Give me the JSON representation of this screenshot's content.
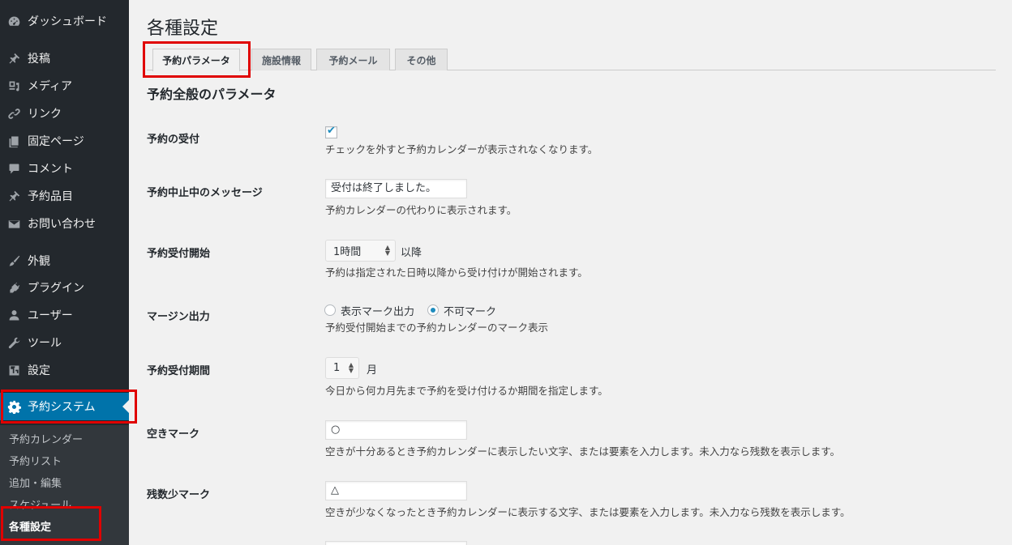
{
  "sidebar": {
    "items": [
      {
        "label": "ダッシュボード",
        "icon": "dashboard-icon"
      },
      {
        "label": "投稿",
        "icon": "pin-icon"
      },
      {
        "label": "メディア",
        "icon": "media-icon"
      },
      {
        "label": "リンク",
        "icon": "link-icon"
      },
      {
        "label": "固定ページ",
        "icon": "page-icon"
      },
      {
        "label": "コメント",
        "icon": "comment-icon"
      },
      {
        "label": "予約品目",
        "icon": "pin-icon"
      },
      {
        "label": "お問い合わせ",
        "icon": "mail-icon"
      },
      {
        "label": "外観",
        "icon": "brush-icon"
      },
      {
        "label": "プラグイン",
        "icon": "plugin-icon"
      },
      {
        "label": "ユーザー",
        "icon": "user-icon"
      },
      {
        "label": "ツール",
        "icon": "wrench-icon"
      },
      {
        "label": "設定",
        "icon": "settings-icon"
      },
      {
        "label": "予約システム",
        "icon": "gear-icon"
      }
    ],
    "submenu": [
      "予約カレンダー",
      "予約リスト",
      "追加・編集",
      "スケジュール",
      "各種設定"
    ]
  },
  "main": {
    "title": "各種設定",
    "tabs": [
      "予約パラメータ",
      "施設情報",
      "予約メール",
      "その他"
    ],
    "section_title": "予約全般のパラメータ",
    "rows": {
      "accept": {
        "label": "予約の受付",
        "checked": true,
        "desc": "チェックを外すと予約カレンダーが表示されなくなります。"
      },
      "stop_message": {
        "label": "予約中止中のメッセージ",
        "value": "受付は終了しました。",
        "desc": "予約カレンダーの代わりに表示されます。"
      },
      "start": {
        "label": "予約受付開始",
        "select_value": "1時間",
        "suffix": "以降",
        "desc": "予約は指定された日時以降から受け付けが開始されます。"
      },
      "margin": {
        "label": "マージン出力",
        "option1": "表示マーク出力",
        "option2": "不可マーク",
        "selected": "不可マーク",
        "desc": "予約受付開始までの予約カレンダーのマーク表示"
      },
      "period": {
        "label": "予約受付期間",
        "select_value": "1",
        "suffix": "月",
        "desc": "今日から何カ月先まで予約を受け付けるか期間を指定します。"
      },
      "vacant": {
        "label": "空きマーク",
        "value": "○",
        "desc": "空きが十分あるとき予約カレンダーに表示したい文字、または要素を入力します。未入力なら残数を表示します。"
      },
      "few": {
        "label": "残数少マーク",
        "value": "△",
        "desc": "空きが少なくなったとき予約カレンダーに表示する文字、または要素を入力します。未入力なら残数を表示します。"
      }
    }
  },
  "colors": {
    "sidebar_bg": "#23282d",
    "submenu_bg": "#32373c",
    "active_bg": "#0073aa",
    "highlight": "#e00000",
    "accent": "#1e8cbe"
  }
}
